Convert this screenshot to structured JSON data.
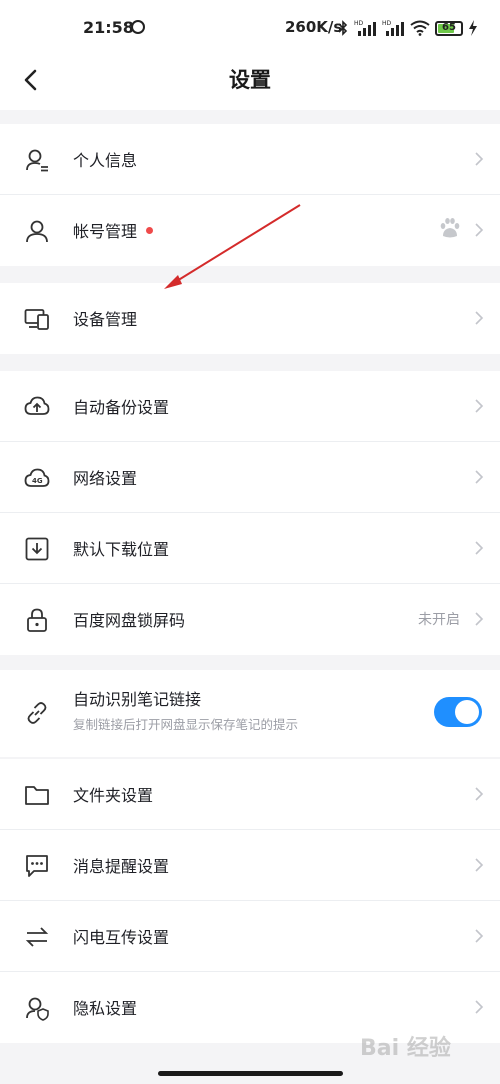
{
  "status_bar": {
    "time": "21:58",
    "network_speed": "260K/s",
    "battery": "65",
    "icons": [
      "bluetooth-icon",
      "hd-signal-icon",
      "hd-signal-icon",
      "wifi-icon",
      "battery-icon",
      "charging-icon"
    ]
  },
  "header": {
    "title": "设置",
    "back_icon": "back-chevron-icon"
  },
  "groups": [
    {
      "items": [
        {
          "icon": "personal-info-icon",
          "label": "个人信息"
        },
        {
          "icon": "account-icon",
          "label": "帐号管理",
          "has_red_dot": true,
          "right_icon": "baidu-paw-icon"
        }
      ]
    },
    {
      "items": [
        {
          "icon": "devices-icon",
          "label": "设备管理"
        }
      ]
    },
    {
      "items": [
        {
          "icon": "cloud-upload-icon",
          "label": "自动备份设置"
        },
        {
          "icon": "network-4g-icon",
          "label": "网络设置"
        },
        {
          "icon": "download-icon",
          "label": "默认下载位置"
        },
        {
          "icon": "lock-icon",
          "label": "百度网盘锁屏码",
          "value": "未开启"
        }
      ]
    },
    {
      "items": [
        {
          "icon": "link-icon",
          "label": "自动识别笔记链接",
          "subtitle": "复制链接后打开网盘显示保存笔记的提示",
          "toggle": true
        }
      ]
    },
    {
      "items": [
        {
          "icon": "folder-icon",
          "label": "文件夹设置"
        },
        {
          "icon": "message-icon",
          "label": "消息提醒设置"
        },
        {
          "icon": "transfer-icon",
          "label": "闪电互传设置"
        },
        {
          "icon": "privacy-icon",
          "label": "隐私设置"
        }
      ]
    }
  ],
  "watermark": "Bai 经验",
  "colors": {
    "accent": "#1f8fff",
    "red_dot": "#ef4a4a",
    "annotation_arrow": "#d42b2b",
    "background": "#f4f4f6"
  }
}
